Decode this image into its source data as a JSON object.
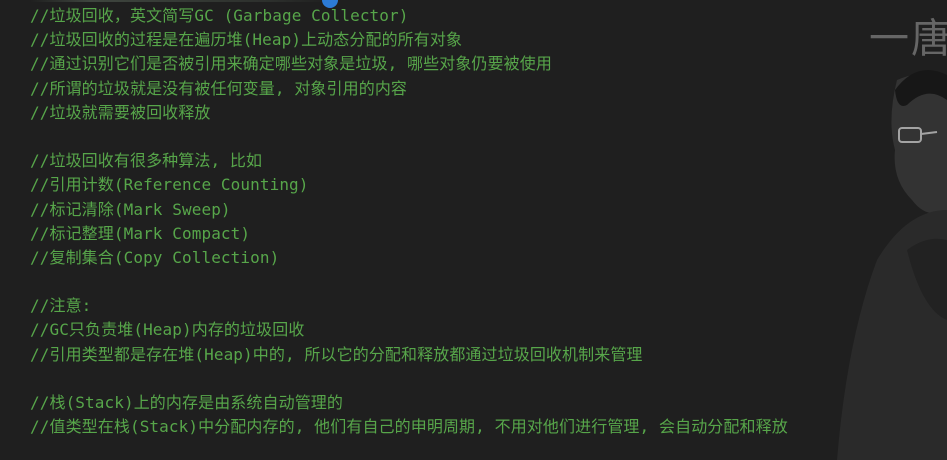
{
  "overlay": {
    "brand_text": "一唐"
  },
  "code_lines": [
    "//垃圾回收，英文简写GC (Garbage Collector)",
    "//垃圾回收的过程是在遍历堆(Heap)上动态分配的所有对象",
    "//通过识别它们是否被引用来确定哪些对象是垃圾, 哪些对象仍要被使用",
    "//所谓的垃圾就是没有被任何变量, 对象引用的内容",
    "//垃圾就需要被回收释放",
    "",
    "//垃圾回收有很多种算法, 比如",
    "//引用计数(Reference Counting)",
    "//标记清除(Mark Sweep)",
    "//标记整理(Mark Compact)",
    "//复制集合(Copy Collection)",
    "",
    "//注意:",
    "//GC只负责堆(Heap)内存的垃圾回收",
    "//引用类型都是存在堆(Heap)中的, 所以它的分配和释放都通过垃圾回收机制来管理",
    "",
    "//栈(Stack)上的内存是由系统自动管理的",
    "//值类型在栈(Stack)中分配内存的, 他们有自己的申明周期, 不用对他们进行管理, 会自动分配和释放"
  ],
  "colors": {
    "background": "#1f1f1f",
    "comment": "#57a64a",
    "accent_dot": "#2c7bd6"
  },
  "icons": {
    "presenter": "presenter-silhouette"
  }
}
